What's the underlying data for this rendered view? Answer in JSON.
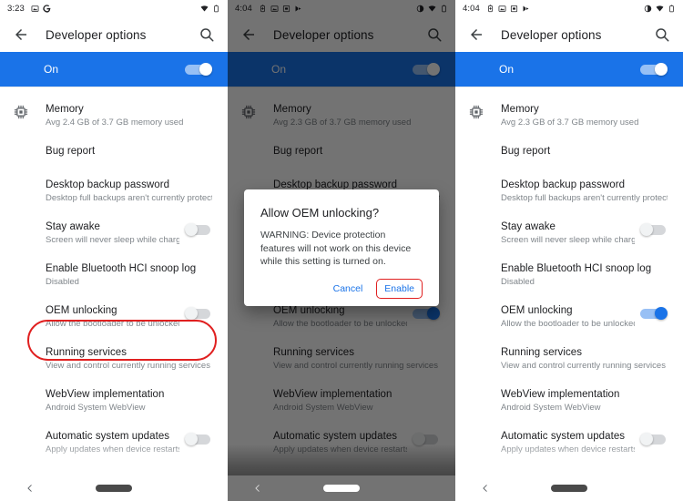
{
  "app": {
    "title": "Developer options",
    "back_icon": "arrow-back-icon",
    "search_icon": "search-icon",
    "master_switch_label": "On"
  },
  "colors": {
    "accent_blue": "#1a73e8",
    "annotation_red": "#e02020",
    "text_primary": "#202124",
    "text_secondary": "#80868b",
    "scrim": "rgba(0,0,0,0.55)"
  },
  "panels": [
    {
      "id": "panel-before",
      "status": {
        "time": "3:23",
        "left_icons": [
          "screenshot-icon",
          "google-icon"
        ],
        "right_icons": [
          "wifi-icon",
          "battery-icon"
        ]
      },
      "master_switch_on": true,
      "dimmed": false,
      "rows": [
        {
          "name": "memory",
          "icon": "memory-chip-icon",
          "title": "Memory",
          "subtitle": "Avg 2.4 GB of 3.7 GB memory used",
          "toggle": "none"
        },
        {
          "name": "bug-report",
          "icon": "none",
          "title": "Bug report",
          "subtitle": "",
          "toggle": "none"
        },
        {
          "name": "desktop-backup-password",
          "icon": "none",
          "title": "Desktop backup password",
          "subtitle": "Desktop full backups aren't currently protected",
          "toggle": "none"
        },
        {
          "name": "stay-awake",
          "icon": "none",
          "title": "Stay awake",
          "subtitle": "Screen will never sleep while charging",
          "toggle": "off"
        },
        {
          "name": "bluetooth-hci-snoop-log",
          "icon": "none",
          "title": "Enable Bluetooth HCI snoop log",
          "subtitle": "Disabled",
          "toggle": "none"
        },
        {
          "name": "oem-unlocking",
          "icon": "none",
          "title": "OEM unlocking",
          "subtitle": "Allow the bootloader to be unlocked",
          "toggle": "off"
        },
        {
          "name": "running-services",
          "icon": "none",
          "title": "Running services",
          "subtitle": "View and control currently running services",
          "toggle": "none"
        },
        {
          "name": "webview-implementation",
          "icon": "none",
          "title": "WebView implementation",
          "subtitle": "Android System WebView",
          "toggle": "none"
        },
        {
          "name": "automatic-system-updates",
          "icon": "none",
          "title": "Automatic system updates",
          "subtitle": "Apply updates when device restarts",
          "toggle": "off"
        }
      ],
      "annotation": {
        "type": "ellipse",
        "target": "oem-unlocking"
      },
      "dialog": null,
      "navbar": {
        "back_icon": "chevron-back-icon",
        "home_pill": "home-pill-indicator",
        "pill_color": "dark"
      }
    },
    {
      "id": "panel-dialog",
      "status": {
        "time": "4:04",
        "left_icons": [
          "battery-saver-icon",
          "screenshot-icon",
          "sim-icon",
          "play-icon"
        ],
        "right_icons": [
          "dnd-icon",
          "wifi-icon",
          "battery-icon"
        ]
      },
      "master_switch_on": true,
      "dimmed": true,
      "rows": [
        {
          "name": "memory",
          "icon": "memory-chip-icon",
          "title": "Memory",
          "subtitle": "Avg 2.3 GB of 3.7 GB memory used",
          "toggle": "none"
        },
        {
          "name": "bug-report",
          "icon": "none",
          "title": "Bug report",
          "subtitle": "",
          "toggle": "none"
        },
        {
          "name": "desktop-backup-password",
          "icon": "none",
          "title": "Desktop backup password",
          "subtitle": "Desktop full backups aren't currently protected",
          "toggle": "none"
        },
        {
          "name": "stay-awake",
          "icon": "none",
          "title": "Stay awake",
          "subtitle": "Screen will never sleep while charging",
          "toggle": "off"
        },
        {
          "name": "bluetooth-hci-snoop-log",
          "icon": "none",
          "title": "Enable Bluetooth HCI snoop log",
          "subtitle": "Disabled",
          "toggle": "none"
        },
        {
          "name": "oem-unlocking",
          "icon": "none",
          "title": "OEM unlocking",
          "subtitle": "Allow the bootloader to be unlocked",
          "toggle": "on"
        },
        {
          "name": "running-services",
          "icon": "none",
          "title": "Running services",
          "subtitle": "View and control currently running services",
          "toggle": "none"
        },
        {
          "name": "webview-implementation",
          "icon": "none",
          "title": "WebView implementation",
          "subtitle": "Android System WebView",
          "toggle": "none"
        },
        {
          "name": "automatic-system-updates",
          "icon": "none",
          "title": "Automatic system updates",
          "subtitle": "Apply updates when device restarts",
          "toggle": "off"
        }
      ],
      "annotation": {
        "type": "button-box",
        "target": "dialog-enable-button"
      },
      "dialog": {
        "title": "Allow OEM unlocking?",
        "body": "WARNING: Device protection features will not work on this device while this setting is turned on.",
        "cancel_label": "Cancel",
        "confirm_label": "Enable"
      },
      "navbar": {
        "back_icon": "chevron-back-icon",
        "home_pill": "home-pill-indicator",
        "pill_color": "light"
      }
    },
    {
      "id": "panel-after",
      "status": {
        "time": "4:04",
        "left_icons": [
          "battery-saver-icon",
          "screenshot-icon",
          "sim-icon",
          "play-icon"
        ],
        "right_icons": [
          "dnd-icon",
          "wifi-icon",
          "battery-icon"
        ]
      },
      "master_switch_on": true,
      "dimmed": false,
      "rows": [
        {
          "name": "memory",
          "icon": "memory-chip-icon",
          "title": "Memory",
          "subtitle": "Avg 2.3 GB of 3.7 GB memory used",
          "toggle": "none"
        },
        {
          "name": "bug-report",
          "icon": "none",
          "title": "Bug report",
          "subtitle": "",
          "toggle": "none"
        },
        {
          "name": "desktop-backup-password",
          "icon": "none",
          "title": "Desktop backup password",
          "subtitle": "Desktop full backups aren't currently protected",
          "toggle": "none"
        },
        {
          "name": "stay-awake",
          "icon": "none",
          "title": "Stay awake",
          "subtitle": "Screen will never sleep while charging",
          "toggle": "off"
        },
        {
          "name": "bluetooth-hci-snoop-log",
          "icon": "none",
          "title": "Enable Bluetooth HCI snoop log",
          "subtitle": "Disabled",
          "toggle": "none"
        },
        {
          "name": "oem-unlocking",
          "icon": "none",
          "title": "OEM unlocking",
          "subtitle": "Allow the bootloader to be unlocked",
          "toggle": "on"
        },
        {
          "name": "running-services",
          "icon": "none",
          "title": "Running services",
          "subtitle": "View and control currently running services",
          "toggle": "none"
        },
        {
          "name": "webview-implementation",
          "icon": "none",
          "title": "WebView implementation",
          "subtitle": "Android System WebView",
          "toggle": "none"
        },
        {
          "name": "automatic-system-updates",
          "icon": "none",
          "title": "Automatic system updates",
          "subtitle": "Apply updates when device restarts",
          "toggle": "off"
        }
      ],
      "annotation": null,
      "dialog": null,
      "navbar": {
        "back_icon": "chevron-back-icon",
        "home_pill": "home-pill-indicator",
        "pill_color": "dark"
      }
    }
  ]
}
